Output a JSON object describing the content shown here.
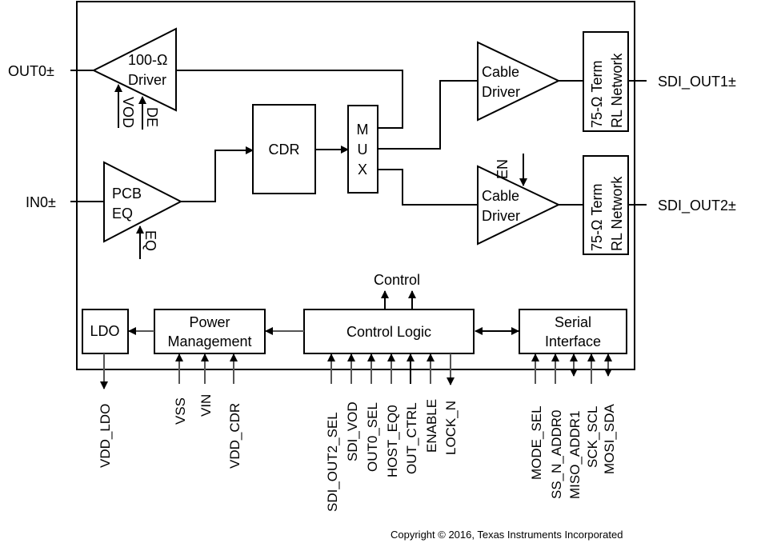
{
  "diagram": {
    "external_pins": {
      "out0": "OUT0±",
      "in0": "IN0±",
      "sdi_out1": "SDI_OUT1±",
      "sdi_out2": "SDI_OUT2±"
    },
    "blocks": {
      "driver100": {
        "line1": "100-Ω",
        "line2": "Driver"
      },
      "pcb_eq": {
        "line1": "PCB",
        "line2": "EQ"
      },
      "cdr": {
        "label": "CDR"
      },
      "mux": {
        "l1": "M",
        "l2": "U",
        "l3": "X"
      },
      "cable_driver1": {
        "line1": "Cable",
        "line2": "Driver"
      },
      "cable_driver2": {
        "line1": "Cable",
        "line2": "Driver"
      },
      "term1": {
        "line1": "75-Ω Term",
        "line2": "RL Network"
      },
      "term2": {
        "line1": "75-Ω Term",
        "line2": "RL Network"
      },
      "ldo": {
        "label": "LDO"
      },
      "power_mgmt": {
        "line1": "Power",
        "line2": "Management"
      },
      "control_logic": {
        "label": "Control Logic"
      },
      "serial_if": {
        "line1": "Serial",
        "line2": "Interface"
      }
    },
    "control_signals": {
      "vod": "VOD",
      "de": "DE",
      "eq": "EQ",
      "en": "EN",
      "control": "Control"
    },
    "power_pins": [
      "VDD_LDO",
      "VSS",
      "VIN",
      "VDD_CDR"
    ],
    "control_pins": [
      "SDI_OUT2_SEL",
      "SDI_VOD",
      "OUT0_SEL",
      "HOST_EQ0",
      "OUT_CTRL",
      "ENABLE",
      "LOCK_N"
    ],
    "serial_pins": [
      "MODE_SEL",
      "SS_N_ADDR0",
      "MISO_ADDR1",
      "SCK_SCL",
      "MOSI_SDA"
    ],
    "copyright": "Copyright © 2016, Texas Instruments Incorporated"
  }
}
